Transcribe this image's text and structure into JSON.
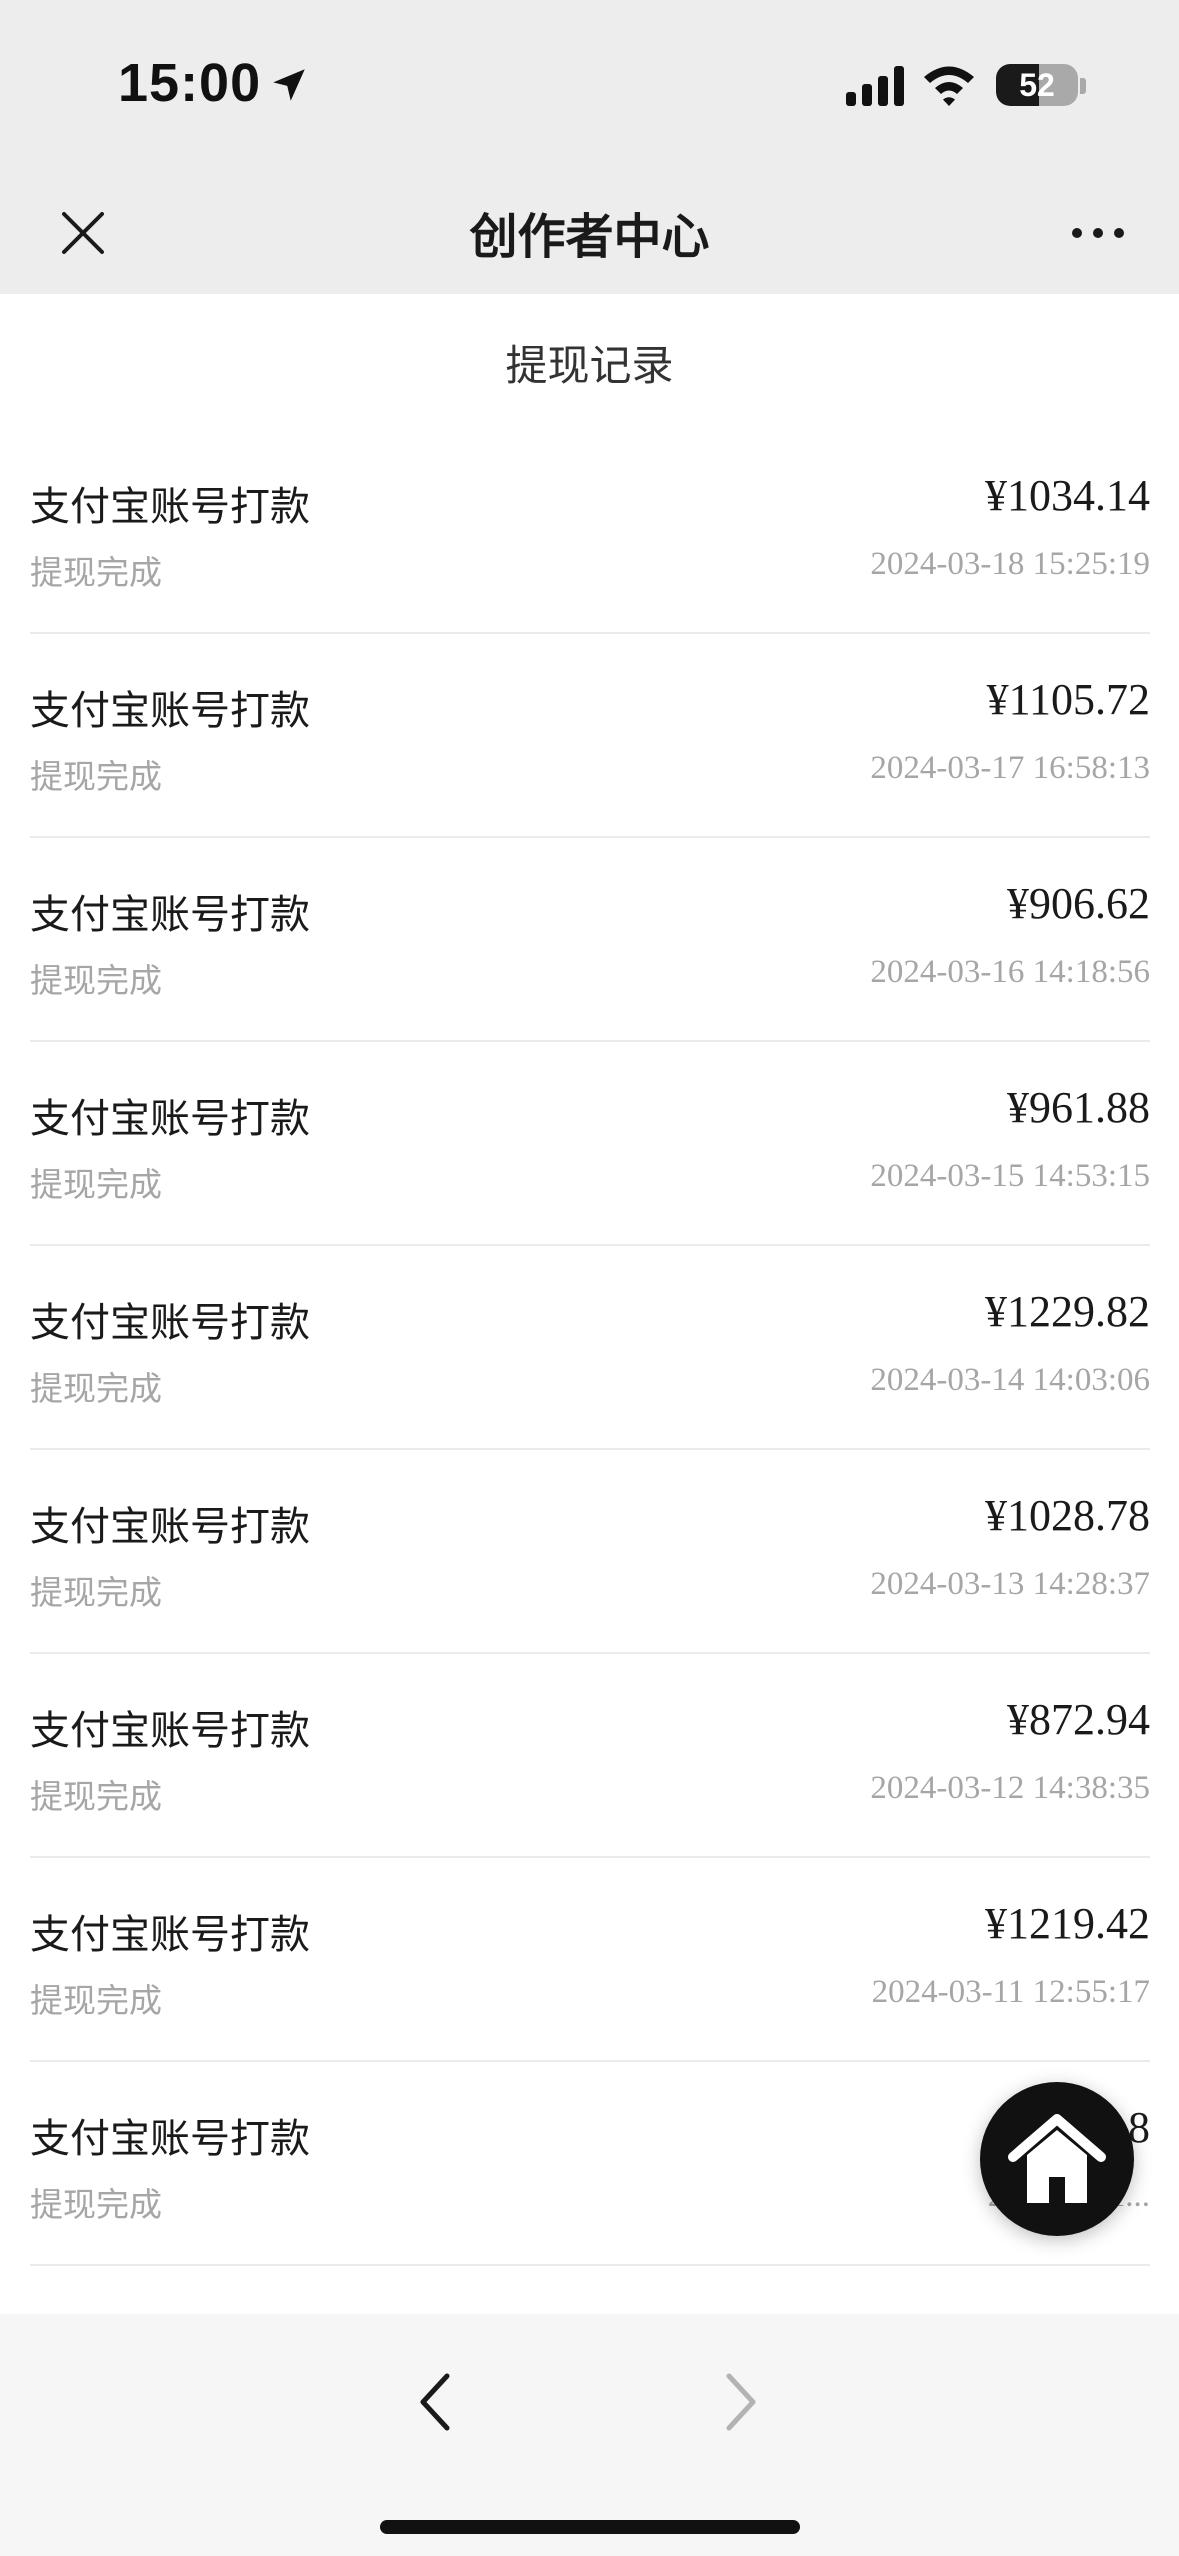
{
  "status_bar": {
    "time": "15:00",
    "battery_level": 52,
    "battery_text": "52",
    "icons": [
      "location-arrow-icon",
      "cellular-signal-icon",
      "wifi-icon",
      "battery-icon"
    ]
  },
  "nav": {
    "title": "创作者中心",
    "close_icon": "close-icon",
    "more_icon": "more-icon"
  },
  "page": {
    "heading": "提现记录"
  },
  "records": [
    {
      "method": "支付宝账号打款",
      "status": "提现完成",
      "amount": "¥1034.14",
      "time": "2024-03-18 15:25:19"
    },
    {
      "method": "支付宝账号打款",
      "status": "提现完成",
      "amount": "¥1105.72",
      "time": "2024-03-17 16:58:13"
    },
    {
      "method": "支付宝账号打款",
      "status": "提现完成",
      "amount": "¥906.62",
      "time": "2024-03-16 14:18:56"
    },
    {
      "method": "支付宝账号打款",
      "status": "提现完成",
      "amount": "¥961.88",
      "time": "2024-03-15 14:53:15"
    },
    {
      "method": "支付宝账号打款",
      "status": "提现完成",
      "amount": "¥1229.82",
      "time": "2024-03-14 14:03:06"
    },
    {
      "method": "支付宝账号打款",
      "status": "提现完成",
      "amount": "¥1028.78",
      "time": "2024-03-13 14:28:37"
    },
    {
      "method": "支付宝账号打款",
      "status": "提现完成",
      "amount": "¥872.94",
      "time": "2024-03-12 14:38:35"
    },
    {
      "method": "支付宝账号打款",
      "status": "提现完成",
      "amount": "¥1219.42",
      "time": "2024-03-11 12:55:17"
    },
    {
      "method": "支付宝账号打款",
      "status": "提现完成",
      "amount": "¥1...8",
      "time": "2024-03-1..."
    }
  ],
  "fab": {
    "icon": "home-icon"
  },
  "bottom_nav": {
    "back_icon": "chevron-left-icon",
    "forward_icon": "chevron-right-icon"
  },
  "colors": {
    "topbar_bg": "#ededed",
    "text_primary": "#1a1a1a",
    "text_secondary": "#a6a6a6",
    "divider": "#ebebeb",
    "bottom_bar_bg": "#f6f6f6",
    "fab_bg": "#111111"
  }
}
